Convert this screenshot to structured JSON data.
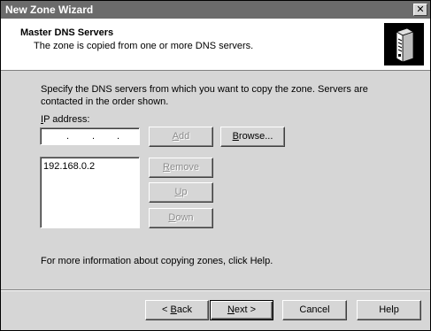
{
  "window": {
    "title": "New Zone Wizard",
    "close_glyph": "✕"
  },
  "header": {
    "title": "Master DNS Servers",
    "subtitle": "The zone is copied from one or more DNS servers.",
    "icon": "server-icon"
  },
  "body": {
    "instructions": "Specify the DNS servers from which you want to copy the zone. Servers are contacted in the order shown.",
    "ip_label_access": "I",
    "ip_label_rest": "P address:",
    "ip_value": "",
    "ip_dots": [
      ".",
      ".",
      "."
    ],
    "servers": [
      "192.168.0.2"
    ],
    "help_text": "For more information about copying zones, click Help."
  },
  "buttons": {
    "add_access": "A",
    "add_rest": "dd",
    "browse_access": "B",
    "browse_rest": "rowse...",
    "remove_access": "R",
    "remove_rest": "emove",
    "up_access": "U",
    "up_rest": "p",
    "down_access": "D",
    "down_rest": "own",
    "back_pre": "< ",
    "back_access": "B",
    "back_rest": "ack",
    "next_access": "N",
    "next_rest": "ext >",
    "cancel": "Cancel",
    "help": "Help"
  }
}
